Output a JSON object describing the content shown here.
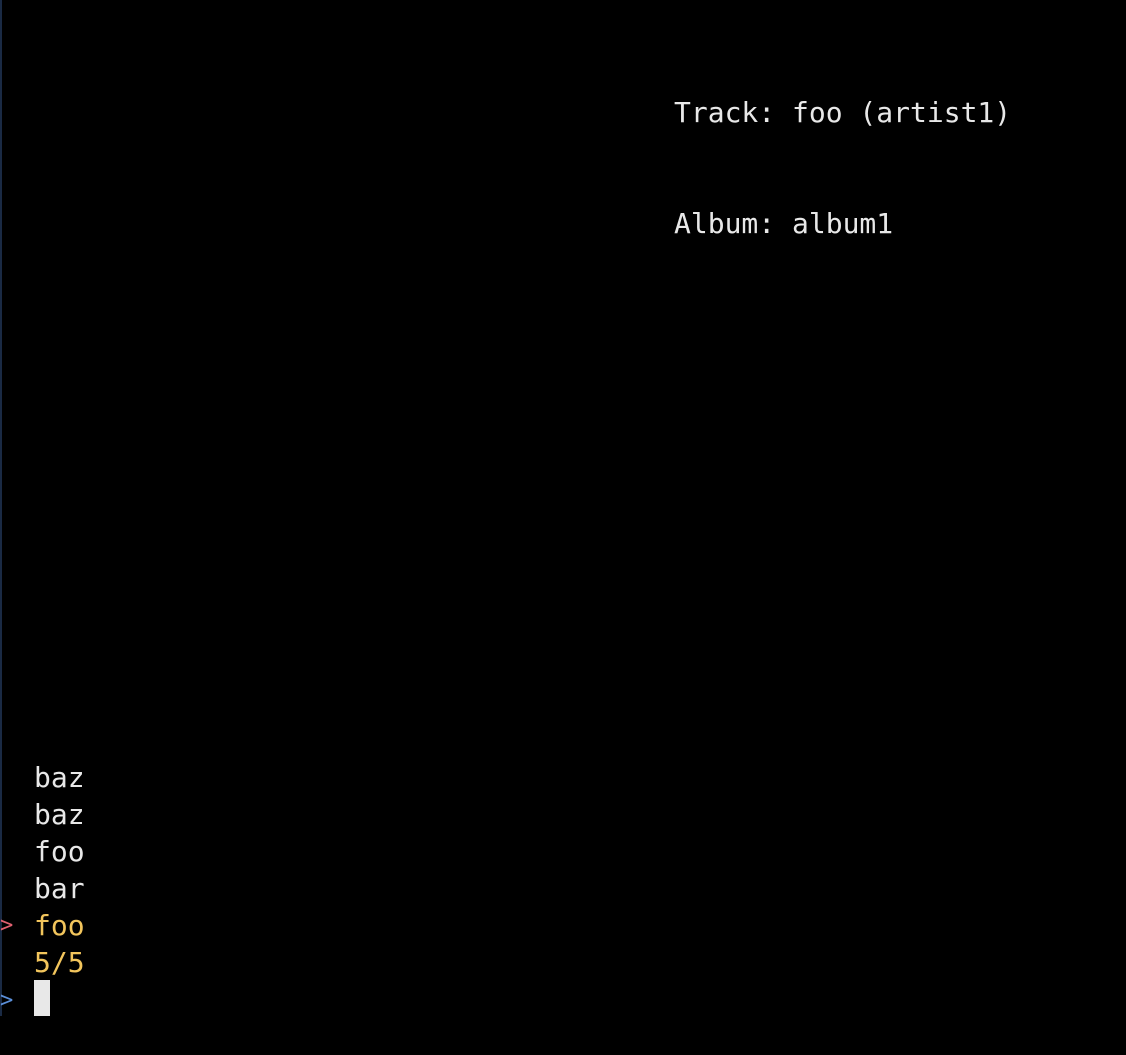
{
  "preview": {
    "track_line": "Track: foo (artist1)",
    "album_line": "Album: album1"
  },
  "results": {
    "items": [
      {
        "label": "baz",
        "selected": false
      },
      {
        "label": "baz",
        "selected": false
      },
      {
        "label": "foo",
        "selected": false
      },
      {
        "label": "bar",
        "selected": false
      },
      {
        "label": "foo",
        "selected": true
      }
    ],
    "pointer_symbol": ">",
    "counter": "5/5"
  },
  "prompt": {
    "symbol": ">",
    "query": ""
  },
  "colors": {
    "background": "#000000",
    "text": "#e8e8e8",
    "highlight": "#f2c55c",
    "pointer": "#e06070",
    "prompt": "#5b8fd9"
  }
}
